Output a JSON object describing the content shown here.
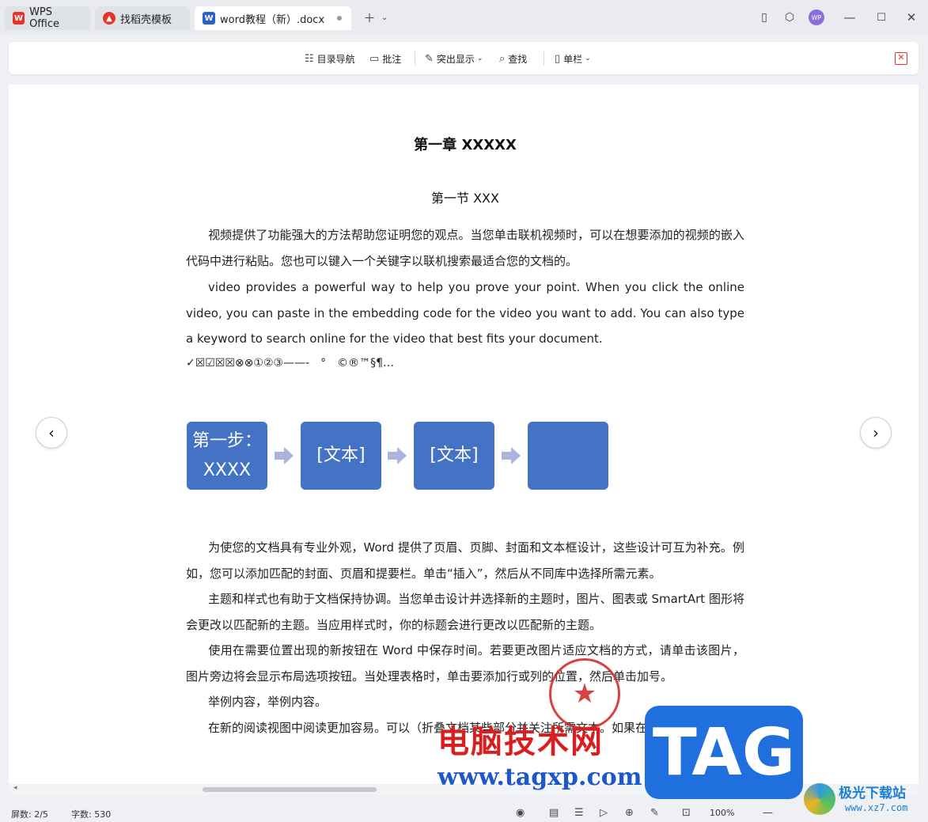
{
  "tabs": {
    "wps": {
      "label": "WPS Office"
    },
    "template": {
      "label": "找稻壳模板"
    },
    "document": {
      "label": "word教程（新）.docx"
    }
  },
  "titlebar": {
    "avatar_text": "WP"
  },
  "toolbar": {
    "toc": "目录导航",
    "comment": "批注",
    "highlight": "突出显示",
    "find": "查找",
    "columns": "单栏"
  },
  "document": {
    "chapter_title": "第一章  XXXXX",
    "section_title": "第一节  XXX",
    "paragraphs": [
      "视频提供了功能强大的方法帮助您证明您的观点。当您单击联机视频时，可以在想要添加的视频的嵌入代码中进行粘贴。您也可以键入一个关键字以联机搜索最适合您的文档的。",
      "video provides a powerful way to help you prove your point. When you click the online video, you can paste in the embedding code for the video you want to add. You can also type a keyword to search online for the video that best fits your document.",
      "✓☒☑☒☒⊗⊗①②③——-　°　©®™§¶…",
      "为使您的文档具有专业外观，Word 提供了页眉、页脚、封面和文本框设计，这些设计可互为补充。例如，您可以添加匹配的封面、页眉和提要栏。单击“插入”，然后从不同库中选择所需元素。",
      "主题和样式也有助于文档保持协调。当您单击设计并选择新的主题时，图片、图表或 SmartArt 图形将会更改以匹配新的主题。当应用样式时，你的标题会进行更改以匹配新的主题。",
      "使用在需要位置出现的新按钮在 Word 中保存时间。若要更改图片适应文档的方式，请单击该图片，图片旁边将会显示布局选项按钮。当处理表格时，单击要添加行或列的位置，然后单击加号。",
      "举例内容，举例内容。",
      "在新的阅读视图中阅读更加容易。可以（折叠文档某些部分并关注所需文本。如果在达到结尾"
    ],
    "smartart": {
      "step1": "第一步：XXXX",
      "step2": "[文本]",
      "step3": "[文本]",
      "step4": ""
    }
  },
  "statusbar": {
    "screens": "屏数: 2/5",
    "wordcount": "字数: 530",
    "zoom": "100%"
  },
  "watermarks": {
    "site_cn": "电脑技术网",
    "site_url": "www.tagxp.com",
    "tag": "TAG",
    "jg_cn": "极光下载站",
    "jg_url": "www.xz7.com"
  },
  "colors": {
    "smartart_fill": "#4472c4",
    "arrow_fill": "#a7b5d9",
    "wps_red": "#e8332a",
    "doc_blue": "#2b5fcc"
  }
}
